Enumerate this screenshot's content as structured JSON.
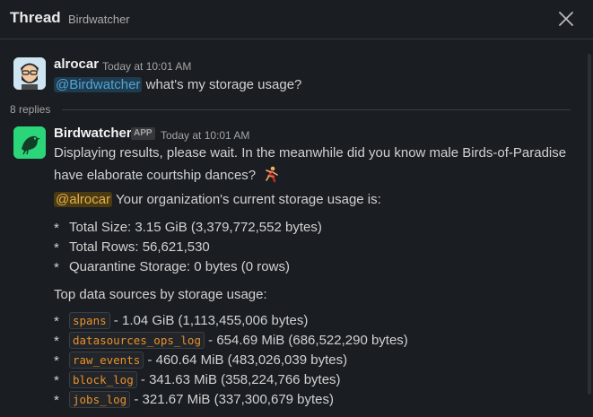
{
  "header": {
    "title": "Thread",
    "channel": "Birdwatcher"
  },
  "parent_message": {
    "author": "alrocar",
    "time": "Today at 10:01 AM",
    "mention": "@Birdwatcher",
    "text": " what's my storage usage?"
  },
  "replies": {
    "label": "8 replies"
  },
  "reply": {
    "author": "Birdwatcher",
    "badge": "APP",
    "time": "Today at 10:01 AM",
    "intro_line1": "Displaying results, please wait. In the meanwhile did you know male Birds-of-Paradise",
    "intro_line2": "have elaborate courtship dances?",
    "mention": "@alrocar",
    "org_text": " Your organization's current storage usage is:",
    "stats": [
      "Total Size: 3.15 GiB (3,379,772,552 bytes)",
      "Total Rows: 56,621,530",
      "Quarantine Storage: 0 bytes (0 rows)"
    ],
    "top_heading": "Top data sources by storage usage:",
    "sources": [
      {
        "name": "spans",
        "detail": " - 1.04 GiB (1,113,455,006 bytes)"
      },
      {
        "name": "datasources_ops_log",
        "detail": " - 654.69 MiB (686,522,290 bytes)"
      },
      {
        "name": "raw_events",
        "detail": " - 460.64 MiB (483,026,039 bytes)"
      },
      {
        "name": "block_log",
        "detail": " - 341.63 MiB (358,224,766 bytes)"
      },
      {
        "name": "jobs_log",
        "detail": " - 321.67 MiB (337,300,679 bytes)"
      }
    ]
  },
  "bullet_char": "*",
  "colors": {
    "background": "#1a1d21",
    "mention_blue": "#4fa6d9",
    "mention_gold": "#e8b04a",
    "code_orange": "#e8912d",
    "bot_green": "#2bd67b"
  }
}
